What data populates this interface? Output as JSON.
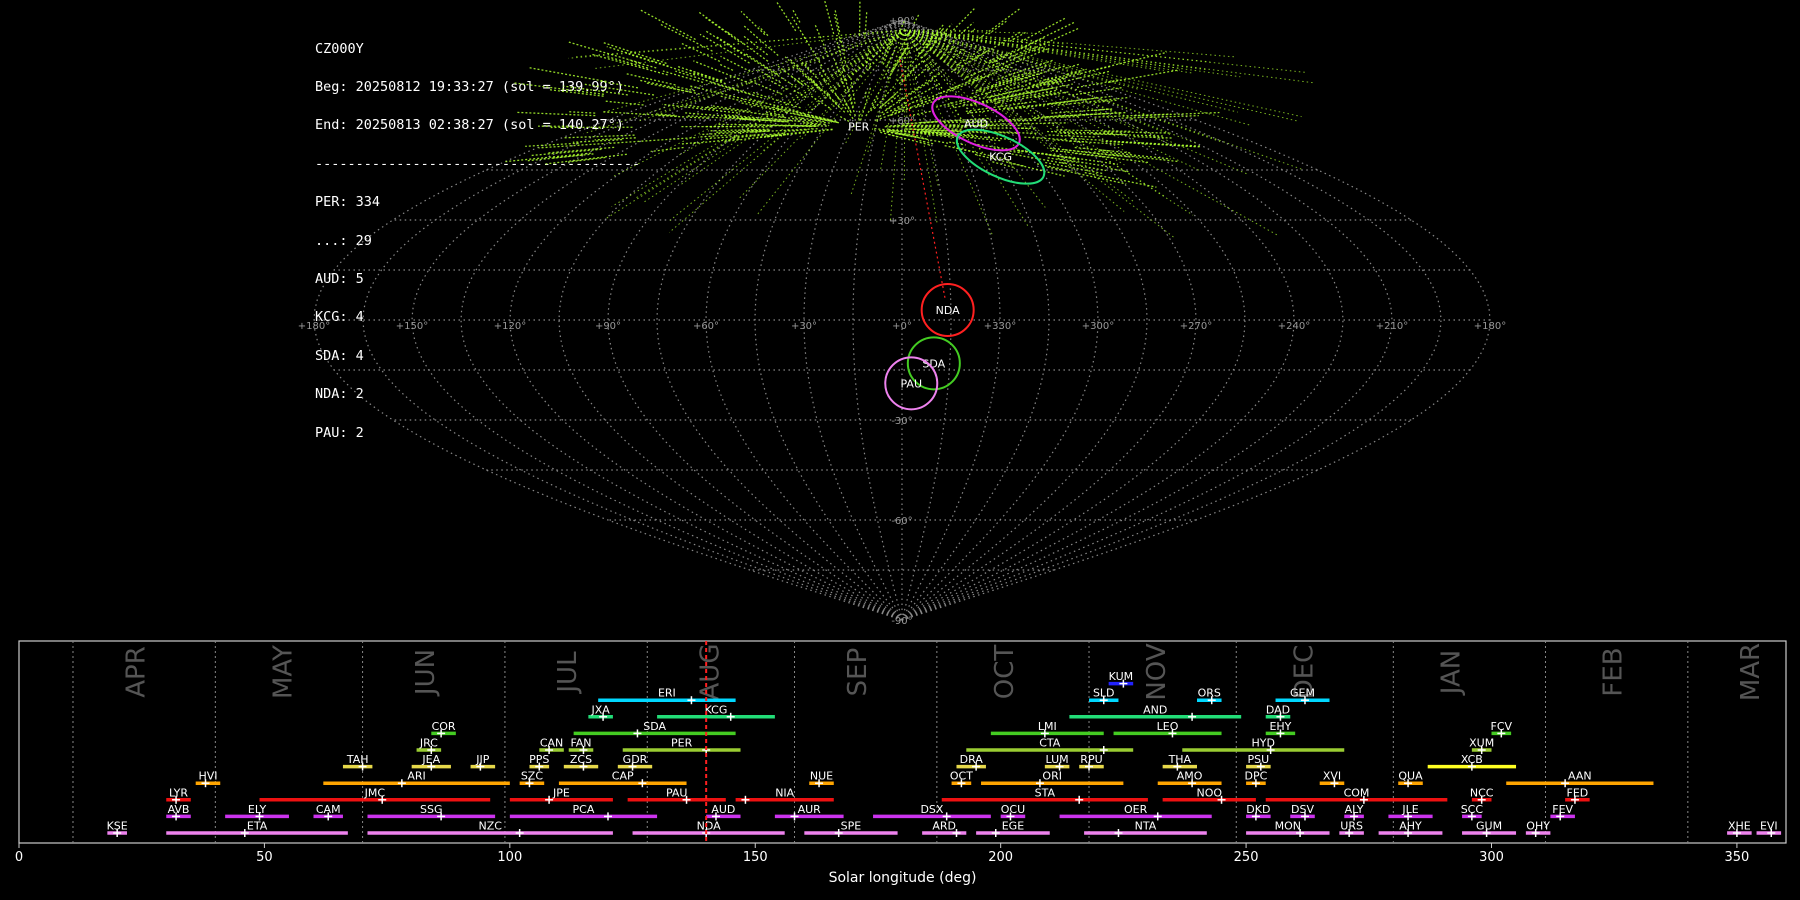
{
  "info": {
    "station": "CZ000Y",
    "begin": "Beg: 20250812 19:33:27 (sol = 139.99°)",
    "end": "End: 20250813 02:38:27 (sol = 140.27°)",
    "separator": "----------------------------------------",
    "counts": [
      "PER: 334",
      "...: 29",
      "AUD: 5",
      "KCG: 4",
      "SDA: 4",
      "NDA: 2",
      "PAU: 2"
    ]
  },
  "colors": {
    "background": "#000000",
    "sporadic_trails": "#adff2f",
    "PER": "#ff2020",
    "AUD": "#e020e0",
    "KCG": "#22dd77",
    "NDA": "#ff2020",
    "SDA": "#44cc22",
    "PAU": "#ee82ee",
    "red_marker": "#ff2020"
  },
  "chart_data": [
    {
      "type": "scatter",
      "title": "",
      "projection": "sinusoidal",
      "lon_ticks": [
        "+180°",
        "+150°",
        "+120°",
        "+90°",
        "+60°",
        "+30°",
        "+0°",
        "+330°",
        "+300°",
        "+270°",
        "+240°",
        "+210°",
        "+180°"
      ],
      "lat_ticks": [
        "+90°",
        "+60°",
        "+30°",
        "-30°",
        "-60°",
        "-90°"
      ],
      "grid": true,
      "radiants": [
        {
          "name": "PER",
          "lon": 25,
          "lat": 58,
          "color": "#ff2020",
          "radius_deg": 0
        },
        {
          "name": "AUD",
          "lon": 316,
          "lat": 59,
          "color": "#e020e0",
          "radius_deg": 7
        },
        {
          "name": "KCG",
          "lon": 314,
          "lat": 49,
          "color": "#22dd77",
          "radius_deg": 7
        },
        {
          "name": "NDA",
          "lon": 346,
          "lat": 3,
          "color": "#ff2020",
          "radius_deg": 5
        },
        {
          "name": "SDA",
          "lon": 350,
          "lat": -13,
          "color": "#44cc22",
          "radius_deg": 5
        },
        {
          "name": "PAU",
          "lon": 357,
          "lat": -19,
          "color": "#ee82ee",
          "radius_deg": 5
        }
      ]
    },
    {
      "type": "bar",
      "title": "",
      "xlabel": "Solar longitude (deg)",
      "xlim": [
        0,
        360
      ],
      "xticks": [
        0,
        50,
        100,
        150,
        200,
        250,
        300,
        350
      ],
      "current_sol": 140,
      "months": [
        {
          "name": "APR",
          "center": 24
        },
        {
          "name": "MAY",
          "center": 54
        },
        {
          "name": "JUN",
          "center": 83
        },
        {
          "name": "JUL",
          "center": 112
        },
        {
          "name": "AUG",
          "center": 141
        },
        {
          "name": "SEP",
          "center": 171
        },
        {
          "name": "OCT",
          "center": 201
        },
        {
          "name": "NOV",
          "center": 232
        },
        {
          "name": "DEC",
          "center": 262
        },
        {
          "name": "JAN",
          "center": 292
        },
        {
          "name": "FEB",
          "center": 325
        },
        {
          "name": "MAR",
          "center": 353
        }
      ],
      "month_bounds": [
        11,
        40,
        70,
        99,
        128,
        158,
        187,
        218,
        248,
        280,
        311,
        340
      ],
      "showers": [
        {
          "name": "KUM",
          "start": 222,
          "end": 227,
          "peak": 225,
          "row": 10,
          "color": "#2222ff"
        },
        {
          "name": "ERI",
          "start": 118,
          "end": 146,
          "peak": 137,
          "row": 9,
          "color": "#00d8ff"
        },
        {
          "name": "SLD",
          "start": 218,
          "end": 224,
          "peak": 221,
          "row": 9,
          "color": "#00d8ff"
        },
        {
          "name": "ORS",
          "start": 240,
          "end": 245,
          "peak": 243,
          "row": 9,
          "color": "#00d8ff"
        },
        {
          "name": "GEM",
          "start": 256,
          "end": 267,
          "peak": 262,
          "row": 9,
          "color": "#00d8ff"
        },
        {
          "name": "JXA",
          "start": 116,
          "end": 121,
          "peak": 119,
          "row": 8,
          "color": "#22dd77"
        },
        {
          "name": "KCG",
          "start": 130,
          "end": 154,
          "peak": 145,
          "row": 8,
          "color": "#22dd77"
        },
        {
          "name": "AND",
          "start": 214,
          "end": 249,
          "peak": 239,
          "row": 8,
          "color": "#22dd77"
        },
        {
          "name": "DAD",
          "start": 254,
          "end": 259,
          "peak": 257,
          "row": 8,
          "color": "#22dd77"
        },
        {
          "name": "COR",
          "start": 84,
          "end": 89,
          "peak": 86,
          "row": 7,
          "color": "#44cc22"
        },
        {
          "name": "SDA",
          "start": 113,
          "end": 146,
          "peak": 126,
          "row": 7,
          "color": "#44cc22"
        },
        {
          "name": "LMI",
          "start": 198,
          "end": 221,
          "peak": 209,
          "row": 7,
          "color": "#44cc22"
        },
        {
          "name": "LEO",
          "start": 223,
          "end": 245,
          "peak": 235,
          "row": 7,
          "color": "#44cc22"
        },
        {
          "name": "EHY",
          "start": 254,
          "end": 260,
          "peak": 257,
          "row": 7,
          "color": "#44cc22"
        },
        {
          "name": "FCV",
          "start": 300,
          "end": 304,
          "peak": 302,
          "row": 7,
          "color": "#44cc22"
        },
        {
          "name": "JRC",
          "start": 81,
          "end": 86,
          "peak": 84,
          "row": 6,
          "color": "#9acd32"
        },
        {
          "name": "CAN",
          "start": 106,
          "end": 111,
          "peak": 108,
          "row": 6,
          "color": "#9acd32"
        },
        {
          "name": "FAN",
          "start": 112,
          "end": 117,
          "peak": 115,
          "row": 6,
          "color": "#9acd32"
        },
        {
          "name": "PER",
          "start": 123,
          "end": 147,
          "peak": 140,
          "row": 6,
          "color": "#9acd32"
        },
        {
          "name": "CTA",
          "start": 193,
          "end": 227,
          "peak": 221,
          "row": 6,
          "color": "#9acd32"
        },
        {
          "name": "HYD",
          "start": 237,
          "end": 270,
          "peak": 255,
          "row": 6,
          "color": "#9acd32"
        },
        {
          "name": "XUM",
          "start": 296,
          "end": 300,
          "peak": 298,
          "row": 6,
          "color": "#9acd32"
        },
        {
          "name": "TAH",
          "start": 66,
          "end": 72,
          "peak": 70,
          "row": 5,
          "color": "#e6d84a"
        },
        {
          "name": "JEA",
          "start": 80,
          "end": 88,
          "peak": 84,
          "row": 5,
          "color": "#e6d84a"
        },
        {
          "name": "JJP",
          "start": 92,
          "end": 97,
          "peak": 94,
          "row": 5,
          "color": "#e6d84a"
        },
        {
          "name": "PPS",
          "start": 104,
          "end": 108,
          "peak": 106,
          "row": 5,
          "color": "#e6d84a"
        },
        {
          "name": "ZCS",
          "start": 111,
          "end": 118,
          "peak": 115,
          "row": 5,
          "color": "#e6d84a"
        },
        {
          "name": "GDR",
          "start": 122,
          "end": 129,
          "peak": 125,
          "row": 5,
          "color": "#e6d84a"
        },
        {
          "name": "DRA",
          "start": 191,
          "end": 197,
          "peak": 195,
          "row": 5,
          "color": "#e6d84a"
        },
        {
          "name": "LUM",
          "start": 209,
          "end": 214,
          "peak": 212,
          "row": 5,
          "color": "#e6d84a"
        },
        {
          "name": "RPU",
          "start": 216,
          "end": 221,
          "peak": 218,
          "row": 5,
          "color": "#e6d84a"
        },
        {
          "name": "THA",
          "start": 233,
          "end": 240,
          "peak": 236,
          "row": 5,
          "color": "#e6d84a"
        },
        {
          "name": "PSU",
          "start": 250,
          "end": 255,
          "peak": 253,
          "row": 5,
          "color": "#e6d84a"
        },
        {
          "name": "XCB",
          "start": 287,
          "end": 305,
          "peak": 296,
          "row": 5,
          "color": "#ffff22"
        },
        {
          "name": "HVI",
          "start": 36,
          "end": 41,
          "peak": 38,
          "row": 4,
          "color": "#ffa500"
        },
        {
          "name": "ARI",
          "start": 62,
          "end": 100,
          "peak": 78,
          "row": 4,
          "color": "#ffa500"
        },
        {
          "name": "SZC",
          "start": 102,
          "end": 107,
          "peak": 104,
          "row": 4,
          "color": "#ffa500"
        },
        {
          "name": "CAP",
          "start": 110,
          "end": 136,
          "peak": 127,
          "row": 4,
          "color": "#ffa500"
        },
        {
          "name": "NUE",
          "start": 161,
          "end": 166,
          "peak": 163,
          "row": 4,
          "color": "#ffa500"
        },
        {
          "name": "OCT",
          "start": 190,
          "end": 194,
          "peak": 192,
          "row": 4,
          "color": "#ffa500"
        },
        {
          "name": "ORI",
          "start": 196,
          "end": 225,
          "peak": 208,
          "row": 4,
          "color": "#ffa500"
        },
        {
          "name": "AMO",
          "start": 232,
          "end": 245,
          "peak": 239,
          "row": 4,
          "color": "#ffa500"
        },
        {
          "name": "DPC",
          "start": 250,
          "end": 254,
          "peak": 252,
          "row": 4,
          "color": "#ffa500"
        },
        {
          "name": "XVI",
          "start": 265,
          "end": 270,
          "peak": 268,
          "row": 4,
          "color": "#ffa500"
        },
        {
          "name": "QUA",
          "start": 281,
          "end": 286,
          "peak": 283,
          "row": 4,
          "color": "#ffa500"
        },
        {
          "name": "AAN",
          "start": 303,
          "end": 333,
          "peak": 315,
          "row": 4,
          "color": "#ffa500"
        },
        {
          "name": "LYR",
          "start": 30,
          "end": 35,
          "peak": 32,
          "row": 3,
          "color": "#ee1111"
        },
        {
          "name": "JMC",
          "start": 49,
          "end": 96,
          "peak": 74,
          "row": 3,
          "color": "#ee1111"
        },
        {
          "name": "JPE",
          "start": 100,
          "end": 121,
          "peak": 108,
          "row": 3,
          "color": "#ee1111"
        },
        {
          "name": "PAU",
          "start": 124,
          "end": 144,
          "peak": 136,
          "row": 3,
          "color": "#ee1111"
        },
        {
          "name": "NIA",
          "start": 146,
          "end": 166,
          "peak": 148,
          "row": 3,
          "color": "#ee1111"
        },
        {
          "name": "STA",
          "start": 188,
          "end": 230,
          "peak": 216,
          "row": 3,
          "color": "#ee1111"
        },
        {
          "name": "NOO",
          "start": 233,
          "end": 252,
          "peak": 245,
          "row": 3,
          "color": "#ee1111"
        },
        {
          "name": "COM",
          "start": 254,
          "end": 291,
          "peak": 274,
          "row": 3,
          "color": "#ee1111"
        },
        {
          "name": "NCC",
          "start": 296,
          "end": 300,
          "peak": 298,
          "row": 3,
          "color": "#ee1111"
        },
        {
          "name": "FED",
          "start": 315,
          "end": 320,
          "peak": 317,
          "row": 3,
          "color": "#ee1111"
        },
        {
          "name": "AVB",
          "start": 30,
          "end": 35,
          "peak": 32,
          "row": 2,
          "color": "#cc33ee"
        },
        {
          "name": "ELY",
          "start": 42,
          "end": 55,
          "peak": 49,
          "row": 2,
          "color": "#cc33ee"
        },
        {
          "name": "CAM",
          "start": 60,
          "end": 66,
          "peak": 63,
          "row": 2,
          "color": "#cc33ee"
        },
        {
          "name": "SSG",
          "start": 71,
          "end": 97,
          "peak": 86,
          "row": 2,
          "color": "#cc33ee"
        },
        {
          "name": "PCA",
          "start": 100,
          "end": 130,
          "peak": 120,
          "row": 2,
          "color": "#cc33ee"
        },
        {
          "name": "AUD",
          "start": 140,
          "end": 147,
          "peak": 142,
          "row": 2,
          "color": "#cc33ee"
        },
        {
          "name": "AUR",
          "start": 154,
          "end": 168,
          "peak": 158,
          "row": 2,
          "color": "#cc33ee"
        },
        {
          "name": "DSX",
          "start": 174,
          "end": 198,
          "peak": 189,
          "row": 2,
          "color": "#cc33ee"
        },
        {
          "name": "OCU",
          "start": 200,
          "end": 205,
          "peak": 202,
          "row": 2,
          "color": "#cc33ee"
        },
        {
          "name": "OER",
          "start": 212,
          "end": 243,
          "peak": 232,
          "row": 2,
          "color": "#cc33ee"
        },
        {
          "name": "DKD",
          "start": 250,
          "end": 255,
          "peak": 252,
          "row": 2,
          "color": "#cc33ee"
        },
        {
          "name": "DSV",
          "start": 259,
          "end": 264,
          "peak": 262,
          "row": 2,
          "color": "#cc33ee"
        },
        {
          "name": "ALY",
          "start": 270,
          "end": 274,
          "peak": 272,
          "row": 2,
          "color": "#cc33ee"
        },
        {
          "name": "JLE",
          "start": 279,
          "end": 288,
          "peak": 283,
          "row": 2,
          "color": "#cc33ee"
        },
        {
          "name": "SCC",
          "start": 294,
          "end": 298,
          "peak": 296,
          "row": 2,
          "color": "#cc33ee"
        },
        {
          "name": "FEV",
          "start": 312,
          "end": 317,
          "peak": 314,
          "row": 2,
          "color": "#cc33ee"
        },
        {
          "name": "KSE",
          "start": 18,
          "end": 22,
          "peak": 20,
          "row": 1,
          "color": "#ee82ee"
        },
        {
          "name": "ETA",
          "start": 30,
          "end": 67,
          "peak": 46,
          "row": 1,
          "color": "#ee82ee"
        },
        {
          "name": "NZC",
          "start": 71,
          "end": 121,
          "peak": 102,
          "row": 1,
          "color": "#ee82ee"
        },
        {
          "name": "NDA",
          "start": 125,
          "end": 156,
          "peak": 140,
          "row": 1,
          "color": "#ee82ee"
        },
        {
          "name": "SPE",
          "start": 160,
          "end": 179,
          "peak": 167,
          "row": 1,
          "color": "#ee82ee"
        },
        {
          "name": "ARD",
          "start": 184,
          "end": 193,
          "peak": 191,
          "row": 1,
          "color": "#ee82ee"
        },
        {
          "name": "EGE",
          "start": 195,
          "end": 210,
          "peak": 199,
          "row": 1,
          "color": "#ee82ee"
        },
        {
          "name": "NTA",
          "start": 217,
          "end": 242,
          "peak": 224,
          "row": 1,
          "color": "#ee82ee"
        },
        {
          "name": "MON",
          "start": 250,
          "end": 267,
          "peak": 261,
          "row": 1,
          "color": "#ee82ee"
        },
        {
          "name": "URS",
          "start": 269,
          "end": 274,
          "peak": 271,
          "row": 1,
          "color": "#ee82ee"
        },
        {
          "name": "AHY",
          "start": 277,
          "end": 290,
          "peak": 283,
          "row": 1,
          "color": "#ee82ee"
        },
        {
          "name": "GUM",
          "start": 294,
          "end": 305,
          "peak": 299,
          "row": 1,
          "color": "#ee82ee"
        },
        {
          "name": "OHY",
          "start": 307,
          "end": 312,
          "peak": 309,
          "row": 1,
          "color": "#ee82ee"
        },
        {
          "name": "XHE",
          "start": 348,
          "end": 353,
          "peak": 350,
          "row": 1,
          "color": "#ee82ee"
        },
        {
          "name": "EVI",
          "start": 354,
          "end": 359,
          "peak": 357,
          "row": 1,
          "color": "#ee82ee"
        }
      ]
    }
  ]
}
